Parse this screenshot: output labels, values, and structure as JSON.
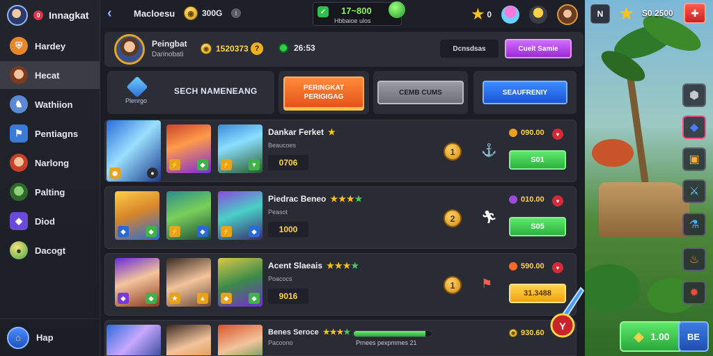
{
  "sidebar": {
    "title": "Innagkat",
    "notif": "0",
    "items": [
      {
        "label": "Hardey",
        "icon": "shield-icon",
        "color": "#e8872a"
      },
      {
        "label": "Hecat",
        "icon": "hero-face-icon",
        "color": "#c9774a",
        "active": true
      },
      {
        "label": "Wathiion",
        "icon": "knight-icon",
        "color": "#5a8ad6"
      },
      {
        "label": "Pentiagns",
        "icon": "banner-icon",
        "color": "#3a7ad8"
      },
      {
        "label": "Narlong",
        "icon": "warrior-icon",
        "color": "#d8603a"
      },
      {
        "label": "Palting",
        "icon": "goblin-icon",
        "color": "#4a9a4a"
      },
      {
        "label": "Diod",
        "icon": "gem-icon",
        "color": "#6a4ad8"
      },
      {
        "label": "Dacogt",
        "icon": "coin-icon",
        "color": "#3aa84a"
      }
    ],
    "footer_label": "Hap"
  },
  "topbar": {
    "title": "Macloesu",
    "coins": "300G",
    "info": "i",
    "center_value": "17~800",
    "center_sub": "Hbbaioe ulos",
    "center_badge": "✓",
    "star_count": "0"
  },
  "profile": {
    "name": "Peingbat",
    "sub": "Darinobati",
    "gold": "1520373",
    "help": "?",
    "energy": "26:53",
    "btn_dark": "Dcnsdsas",
    "btn_purple": "Cuelt Samie"
  },
  "tabs": {
    "search_small": "Plenrgo",
    "search_label": "SECH NAMENEANG",
    "ranking_line1": "PERINGKAT",
    "ranking_line2": "PERIGIGAG",
    "combo_label": "CEMB CUMS",
    "friends_label": "SEAUFRENIY"
  },
  "rows": [
    {
      "name": "Dankar Ferket",
      "stars": "★",
      "green_stars": "",
      "sub": "Beaucoes",
      "score": "0706",
      "rank": "1",
      "action_icon": "hook-icon",
      "points": "090.00",
      "button": "S01",
      "button_style": "green"
    },
    {
      "name": "Piedrac Beneo",
      "stars": "★★★",
      "green_stars": "★",
      "sub": "Peasot",
      "score": "1000",
      "rank": "2",
      "action_icon": "runner-icon",
      "points": "010.00",
      "button": "S05",
      "button_style": "green"
    },
    {
      "name": "Acent Slaeais",
      "stars": "★★★",
      "green_stars": "★",
      "sub": "Poacocs",
      "score": "9016",
      "rank": "1",
      "action_icon": "flag-icon",
      "points": "590.00",
      "button": "31.3488",
      "button_style": "yellow"
    }
  ],
  "row4": {
    "name": "Benes Seroce",
    "stars": "★★★",
    "green_stars": "★",
    "sub": "Pacoono",
    "bar_text": "Prnees pexpmmes 21",
    "bar_progress": 0.92,
    "points": "930.60"
  },
  "scene": {
    "n_label": "N",
    "score": "S0 2500",
    "buy_label": "1.00",
    "menu_label": "BE"
  },
  "colors": {
    "accent_orange": "#e6541a",
    "accent_purple": "#9a2ad8",
    "accent_blue": "#1a55d6",
    "accent_green": "#2bb23e",
    "gold": "#ffd34a"
  }
}
